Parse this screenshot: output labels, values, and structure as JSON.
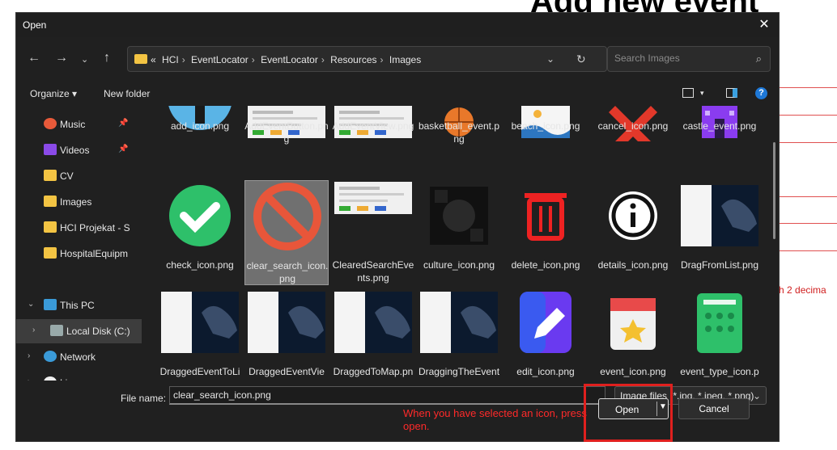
{
  "background": {
    "title": "Add new event",
    "hint": "h 2 decima"
  },
  "dialog": {
    "title": "Open",
    "breadcrumb": [
      "«",
      "HCI",
      "EventLocator",
      "EventLocator",
      "Resources",
      "Images"
    ],
    "search_placeholder": "Search Images",
    "toolbar": {
      "organize": "Organize",
      "new_folder": "New folder"
    },
    "sidebar": [
      {
        "label": "Music",
        "icon": "music-icon",
        "pinned": true
      },
      {
        "label": "Videos",
        "icon": "video-icon",
        "pinned": true
      },
      {
        "label": "CV",
        "icon": "folder-icon",
        "pinned": false
      },
      {
        "label": "Images",
        "icon": "folder-icon",
        "pinned": false
      },
      {
        "label": "HCI Projekat - S",
        "icon": "folder-icon",
        "pinned": false
      },
      {
        "label": "HospitalEquipm",
        "icon": "folder-icon",
        "pinned": false
      },
      {
        "label": "This PC",
        "icon": "pc-icon",
        "pinned": false
      },
      {
        "label": "Local Disk (C:)",
        "icon": "disk-icon",
        "pinned": false
      },
      {
        "label": "Network",
        "icon": "network-icon",
        "pinned": false
      },
      {
        "label": "Linux",
        "icon": "linux-icon",
        "pinned": false
      }
    ],
    "files": [
      {
        "name": "add_icon.png",
        "thumb": "add-icon"
      },
      {
        "name": "AddEventButton.png",
        "thumb": "screenshot"
      },
      {
        "name": "AddEventView.png",
        "thumb": "screenshot"
      },
      {
        "name": "basketball_event.png",
        "thumb": "basketball-icon"
      },
      {
        "name": "beach_icon.png",
        "thumb": "beach-icon"
      },
      {
        "name": "cancel_icon.png",
        "thumb": "cancel-icon"
      },
      {
        "name": "castle_event.png",
        "thumb": "castle-icon"
      },
      {
        "name": "check_icon.png",
        "thumb": "check-icon"
      },
      {
        "name": "clear_search_icon.png",
        "thumb": "clear-search-icon"
      },
      {
        "name": "ClearedSearchEvents.png",
        "thumb": "screenshot"
      },
      {
        "name": "culture_icon.png",
        "thumb": "culture-icon"
      },
      {
        "name": "delete_icon.png",
        "thumb": "delete-icon"
      },
      {
        "name": "details_icon.png",
        "thumb": "details-icon"
      },
      {
        "name": "DragFromList.png",
        "thumb": "map-screenshot"
      },
      {
        "name": "DraggedEventToList.png",
        "thumb": "map-screenshot"
      },
      {
        "name": "DraggedEventView.png",
        "thumb": "map-screenshot"
      },
      {
        "name": "DraggedToMap.png",
        "thumb": "map-screenshot"
      },
      {
        "name": "DraggingTheEventBackToList.png",
        "thumb": "map-screenshot"
      },
      {
        "name": "edit_icon.png",
        "thumb": "edit-icon"
      },
      {
        "name": "event_icon.png",
        "thumb": "event-icon"
      },
      {
        "name": "event_type_icon.png",
        "thumb": "event-type-icon"
      }
    ],
    "file_name_label": "File name:",
    "file_name_value": "clear_search_icon.png",
    "file_type": "Image files (*.jpg, *.jpeg, *.png)",
    "open_label": "Open",
    "cancel_label": "Cancel",
    "annotation": "When you have selected an icon, press open."
  }
}
